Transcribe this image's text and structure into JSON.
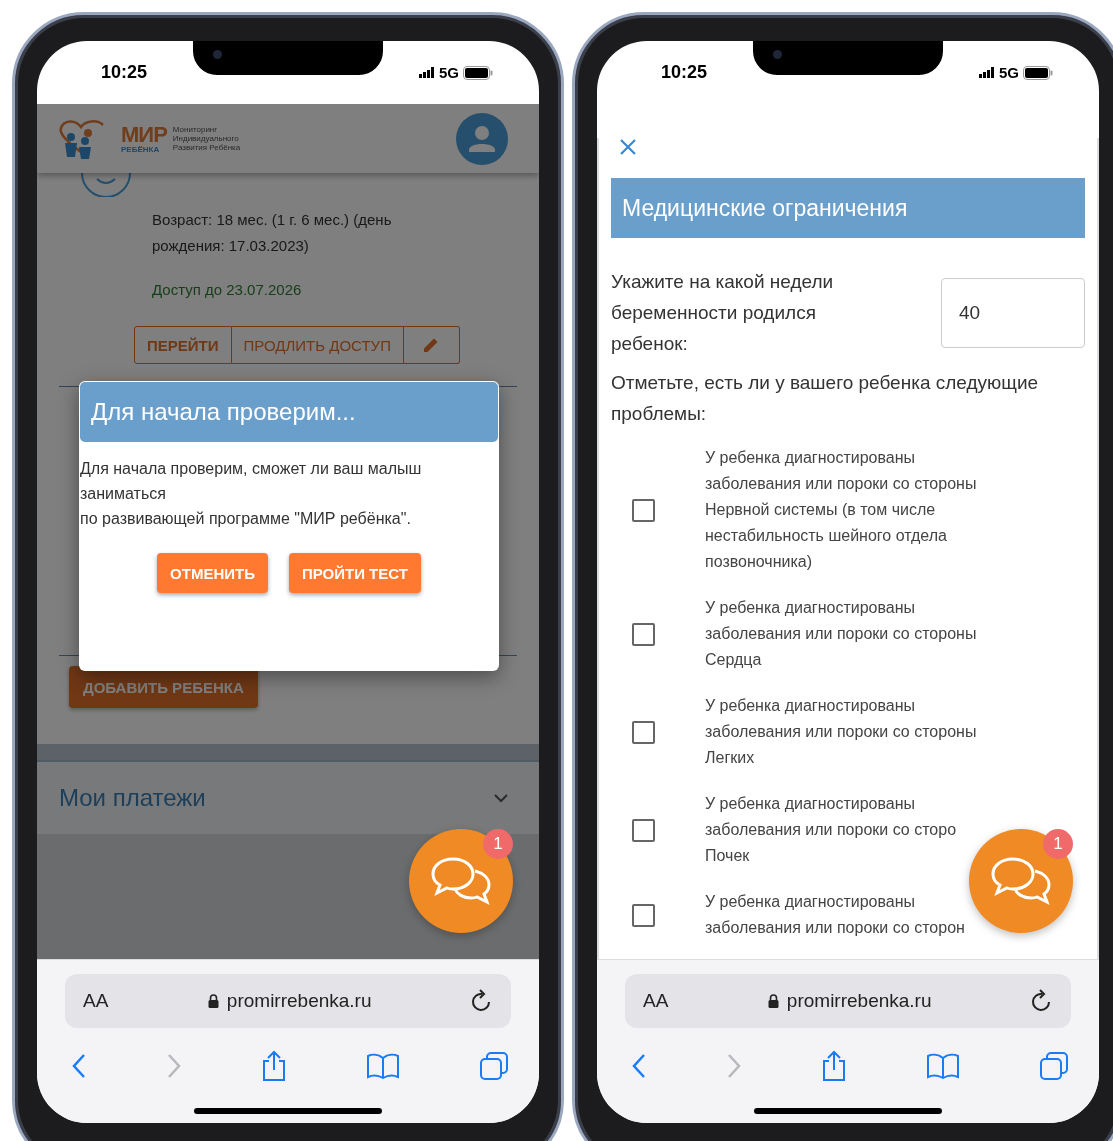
{
  "phones": [
    {
      "status_bar": {
        "time": "10:25",
        "network": "5G"
      },
      "screen": {
        "kind": "dashboard",
        "logo": {
          "wordmark": "МИР",
          "subtitle": "РЕБЁНКА",
          "tagline": [
            "Мониторинг",
            "Индивидуального",
            "Развития Ребёнка"
          ]
        },
        "child": {
          "age": "Возраст: 18 мес. (1 г. 6 мес.) (день рождения: 17.03.2023)",
          "access": "Доступ до 23.07.2026",
          "actions": [
            "ПЕРЕЙТИ",
            "ПРОДЛИТЬ ДОСТУП"
          ]
        },
        "add_child_button": "ДОБАВИТЬ РЕБЕНКА",
        "payments": {
          "title": "Мои платежи",
          "expanded": false
        },
        "dialog": {
          "title": "Для начала проверим...",
          "message": "Для начала проверим, сможет ли ваш малыш заниматься\nпо развивающей программе \"МИР ребёнка\".",
          "buttons": [
            "ОТМЕНИТЬ",
            "ПРОЙТИ ТЕСТ"
          ]
        }
      },
      "chat_button": {
        "badge": "1"
      },
      "browser": {
        "text_size": "AA",
        "url": "promirrebenka.ru",
        "nav": [
          {
            "kind": "back",
            "disabled": false
          },
          {
            "kind": "forward",
            "disabled": true
          },
          {
            "kind": "share",
            "disabled": false
          },
          {
            "kind": "bookmarks",
            "disabled": false
          },
          {
            "kind": "tabs",
            "disabled": false
          }
        ]
      }
    },
    {
      "status_bar": {
        "time": "10:25",
        "network": "5G"
      },
      "screen": {
        "kind": "form",
        "title": "Медицинские ограничения",
        "question": "Укажите на какой недели беременности родился ребенок:",
        "weeks_value": "40",
        "problems_label": "Отметьте, есть ли у вашего ребенка следующие проблемы:",
        "problems": [
          {
            "lines": [
              "У ребенка диагностированы",
              "заболевания или пороки со стороны",
              "Нервной системы (в том числе",
              "нестабильность шейного отдела",
              "позвоночника)"
            ],
            "checked": false
          },
          {
            "lines": [
              "У ребенка диагностированы",
              "заболевания или пороки со стороны",
              "Сердца"
            ],
            "checked": false
          },
          {
            "lines": [
              "У ребенка диагностированы",
              "заболевания или пороки со стороны",
              "Легких"
            ],
            "checked": false
          },
          {
            "lines": [
              "У ребенка диагностированы",
              "заболевания или пороки со сторо",
              "Почек"
            ],
            "checked": false
          },
          {
            "lines": [
              "У ребенка диагностированы",
              "заболевания или пороки со сторон"
            ],
            "checked": false
          }
        ]
      },
      "chat_button": {
        "badge": "1"
      },
      "browser": {
        "text_size": "AA",
        "url": "promirrebenka.ru",
        "nav": [
          {
            "kind": "back",
            "disabled": false
          },
          {
            "kind": "forward",
            "disabled": true
          },
          {
            "kind": "share",
            "disabled": false
          },
          {
            "kind": "bookmarks",
            "disabled": false
          },
          {
            "kind": "tabs",
            "disabled": false
          }
        ]
      }
    }
  ]
}
